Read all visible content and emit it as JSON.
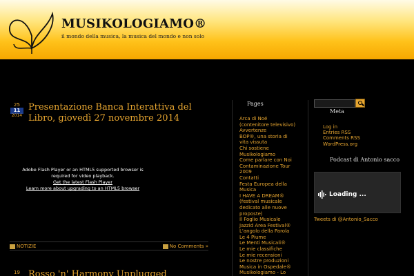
{
  "header": {
    "title": "MUSIKOLOGIAMO®",
    "tagline": "il mondo della musica, la musica del mondo e non solo"
  },
  "post": {
    "date_day": "25",
    "date_month": "11",
    "date_year": "2014",
    "title": "Presentazione Banca Interattiva del Libro, giovedì 27 novembre 2014",
    "flash_line1": "Adobe Flash Player or an HTML5 supported browser is",
    "flash_line2": "required for video playback.",
    "flash_link1": "Get the latest Flash Player",
    "flash_link2": "Learn more about upgrading to an HTML5 browser",
    "category": "NOTIZIE",
    "comments": "No Comments »"
  },
  "post2": {
    "date_day": "19",
    "title": "Rosso 'n' Harmony Unplugged"
  },
  "pages": {
    "title": "Pages",
    "items": [
      "Arca di Noé",
      "(contenitore televisivo)",
      "Avvertenze",
      "BOP®, una storia di",
      "vita vissuta",
      "Chi sostiene",
      "Musikologiamo",
      "Come parlare con Noi",
      "Contaminazione Tour",
      "2009",
      "Contatti",
      "Festa Europea della",
      "Musica",
      "I HAVE A DREAM®",
      "(festival musicale",
      "dedicato alle nuove",
      "proposte)",
      "Il Foglio Musicale",
      "Jazzid Area Festival®",
      "L'angolo della Parola",
      "Le 4 Piume",
      "Le Menti Musicali®",
      "Le mie classifiche",
      "Le mie recensioni",
      "Le nostre produzioni",
      "Musica in Ospedale®",
      "Musikologiamo - Lo"
    ]
  },
  "meta": {
    "title": "Meta",
    "items": [
      "Log in",
      "Entries RSS",
      "Comments RSS",
      "WordPress.org"
    ]
  },
  "podcast": {
    "title": "Podcast di Antonio sacco",
    "loading": "Loading ..."
  },
  "tweets": {
    "label": "Tweets di @Antonio_Sacco"
  },
  "colors": {
    "accent": "#e6a530",
    "background": "#000000",
    "header_top": "#fffbe6",
    "header_bottom": "#f6a700"
  }
}
